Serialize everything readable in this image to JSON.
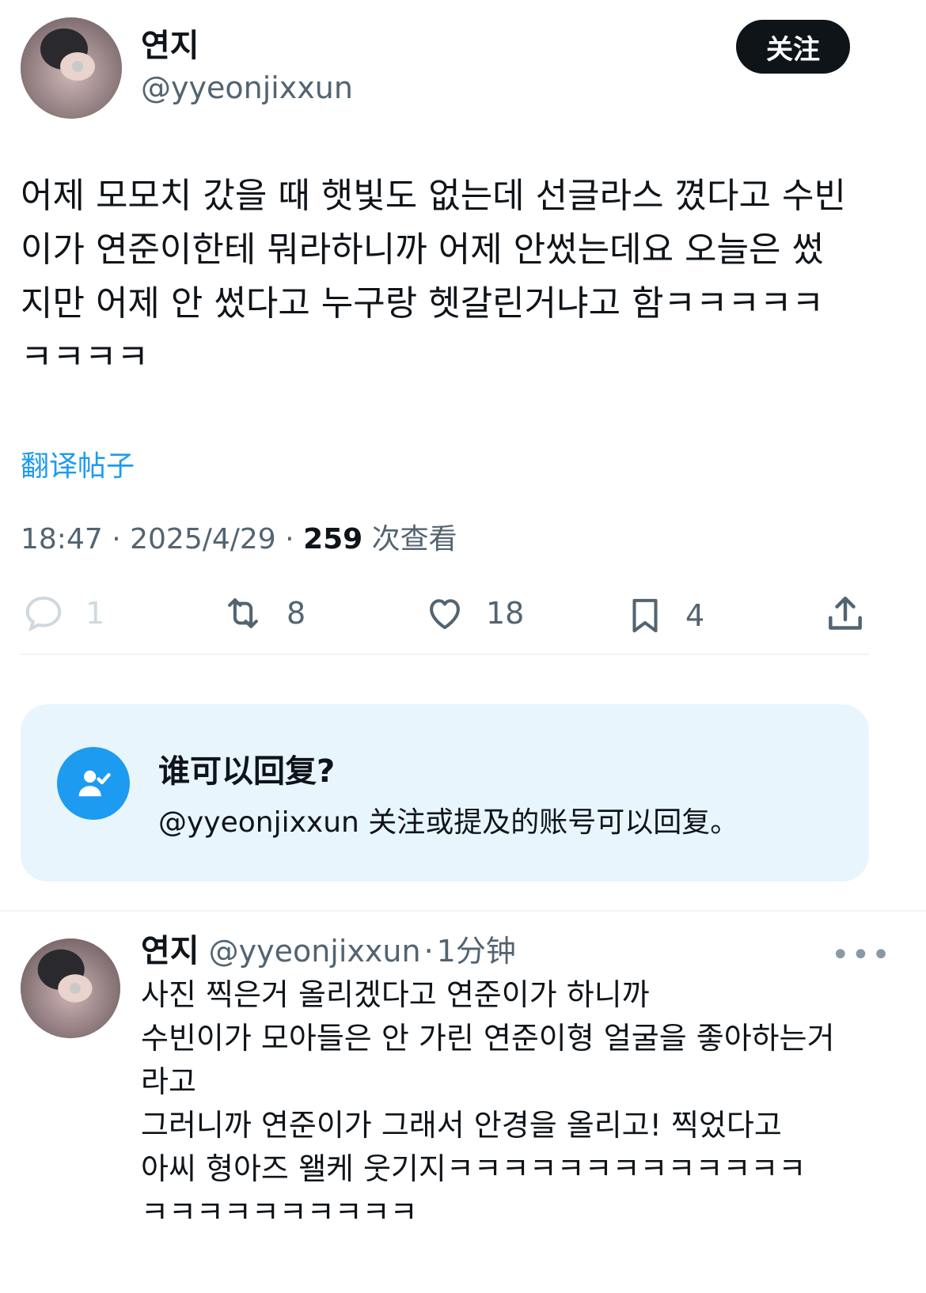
{
  "post": {
    "author_name": "연지",
    "author_handle": "@yyeonjixxun",
    "follow_label": "关注",
    "text": "어제 모모치 갔을 때 햇빛도 없는데 선글라스 꼈다고 수빈\n이가 연준이한테 뭐라하니까 어제 안썼는데요 오늘은 썼\n지만 어제 안 썼다고 누구랑 헷갈린거냐고 함ㅋㅋㅋㅋㅋ\nㅋㅋㅋㅋ",
    "translate_label": "翻译帖子",
    "time": "18:47",
    "date": "2025/4/29",
    "views_count": "259",
    "views_label": "次查看",
    "separator": "·",
    "actions": {
      "reply_count": "1",
      "retweet_count": "8",
      "like_count": "18",
      "bookmark_count": "4"
    }
  },
  "who_can_reply": {
    "title": "谁可以回复?",
    "description": "@yyeonjixxun 关注或提及的账号可以回复。"
  },
  "reply": {
    "author_name": "연지",
    "author_handle": "@yyeonjixxun",
    "separator": "·",
    "time": "1分钟",
    "more_label": "•••",
    "text": "사진 찍은거 올리겠다고 연준이가 하니까\n수빈이가 모아들은 안 가린 연준이형 얼굴을 좋아하는거\n라고\n그러니까 연준이가 그래서 안경을 올리고! 찍었다고\n아씨 형아즈 왤케 웃기지ㅋㅋㅋㅋㅋㅋㅋㅋㅋㅋㅋㅋㅋ\nㅋㅋㅋㅋㅋㅋㅋㅋㅋㅋ"
  },
  "colors": {
    "accent": "#1d9bf0",
    "text": "#0f1419",
    "secondary": "#536471",
    "card_bg": "#e8f5fd"
  }
}
